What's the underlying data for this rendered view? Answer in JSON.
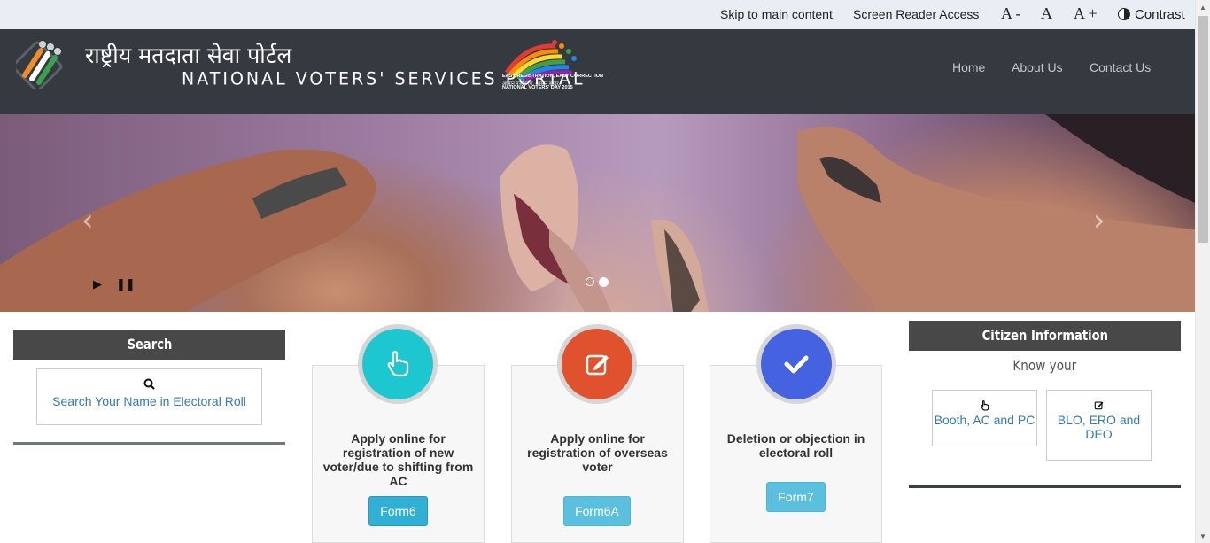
{
  "topbar": {
    "skip_link": "Skip to main content",
    "screen_reader": "Screen Reader Access",
    "font_decrease": "A -",
    "font_normal": "A",
    "font_increase": "A +",
    "contrast": "Contrast"
  },
  "header": {
    "title_hindi": "राष्ट्रीय मतदाता सेवा पोर्टल",
    "title_english": "NATIONAL VOTERS' SERVICES PORTAL",
    "nvd_tagline": "EASY REGISTRATION, EASY CORRECTION",
    "nvd_hindi": "आसान पंजीकरण, आसान सुधार",
    "nvd_name": "NATIONAL VOTERS' DAY 2015",
    "nav": [
      "Home",
      "About Us",
      "Contact Us"
    ]
  },
  "carousel": {
    "prev_icon": "chevron-left-icon",
    "next_icon": "chevron-right-icon",
    "play_icon": "play-icon",
    "pause_icon": "pause-icon",
    "slide_count": 2,
    "active_slide": 2
  },
  "search": {
    "heading": "Search",
    "icon": "search-icon",
    "link_text": "Search Your Name in Electoral Roll"
  },
  "services": [
    {
      "icon": "hand-pointer-icon",
      "color": "#1cc7d0",
      "text": "Apply online for registration of new voter/due to shifting from AC",
      "button": "Form6"
    },
    {
      "icon": "edit-icon",
      "color": "#e0522d",
      "text": "Apply online for registration of overseas voter",
      "button": "Form6A"
    },
    {
      "icon": "check-icon",
      "color": "#4563e0",
      "text": "Deletion or objection in electoral roll",
      "button": "Form7"
    }
  ],
  "citizen": {
    "heading": "Citizen Information",
    "subheading": "Know your",
    "items": [
      {
        "icon": "hand-pointer-icon",
        "label": "Booth, AC and PC"
      },
      {
        "icon": "edit-icon",
        "label": "BLO, ERO and DEO"
      }
    ]
  },
  "colors": {
    "header_bg": "#343a40",
    "topbar_bg": "#e8eef3",
    "panel_head": "#484848",
    "link": "#337ab7",
    "button": "#5bc0de"
  }
}
